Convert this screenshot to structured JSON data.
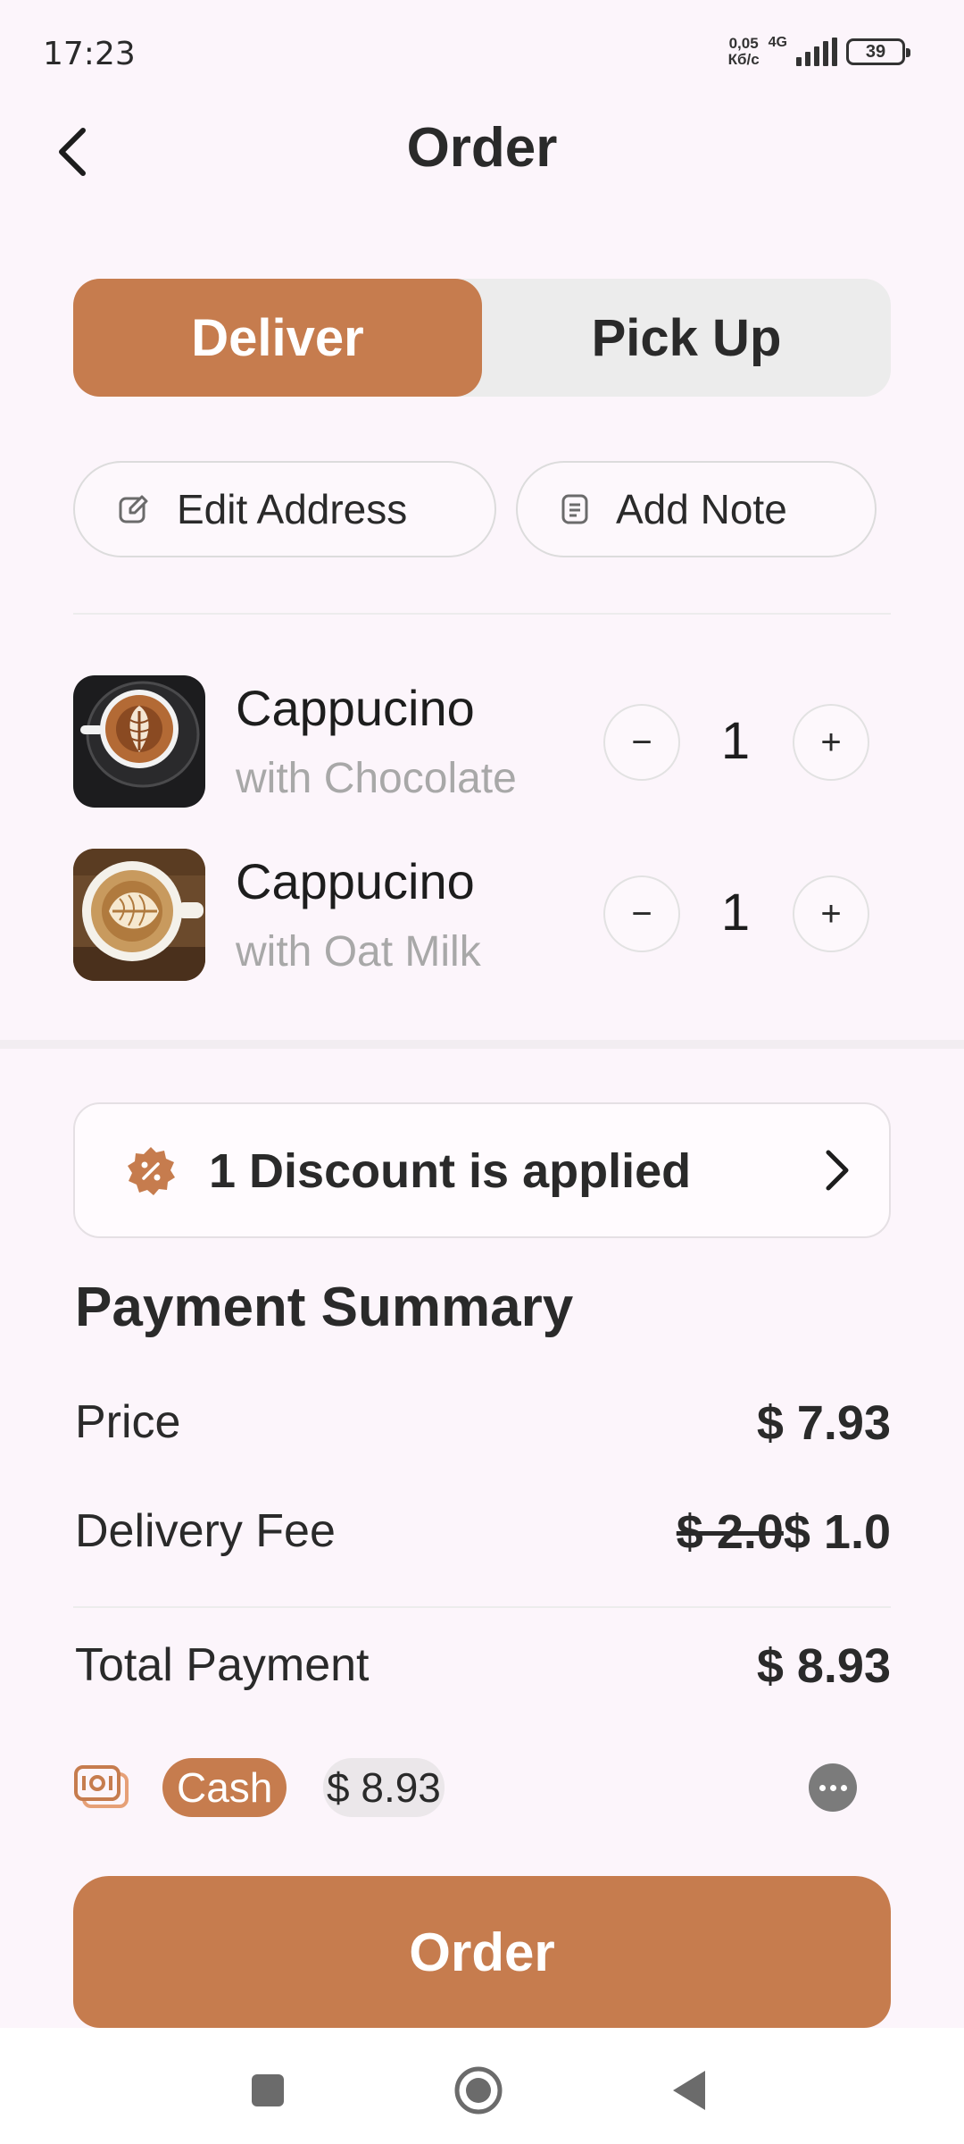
{
  "status_bar": {
    "time": "17:23",
    "net_speed_value": "0,05",
    "net_speed_unit": "Кб/с",
    "network_type": "4G",
    "battery": "39"
  },
  "header": {
    "title": "Order",
    "back_icon": "chevron-left-icon"
  },
  "mode_toggle": {
    "options": [
      "Deliver",
      "Pick Up"
    ],
    "selected": "Deliver"
  },
  "actions": {
    "edit_address": "Edit Address",
    "add_note": "Add Note"
  },
  "items": [
    {
      "name": "Cappucino",
      "variant": "with Chocolate",
      "quantity": "1",
      "decrement": "−",
      "increment": "+"
    },
    {
      "name": "Cappucino",
      "variant": "with Oat Milk",
      "quantity": "1",
      "decrement": "−",
      "increment": "+"
    }
  ],
  "discount": {
    "label": "1 Discount is applied",
    "icon": "discount-badge-icon"
  },
  "payment_summary": {
    "title": "Payment Summary",
    "price_label": "Price",
    "price_value": "$ 7.93",
    "delivery_label": "Delivery Fee",
    "delivery_original": "$ 2.0",
    "delivery_discounted": "$ 1.0",
    "total_label": "Total Payment",
    "total_value": "$ 8.93"
  },
  "payment_method": {
    "method": "Cash",
    "amount": "$ 8.93",
    "icon": "cash-icon"
  },
  "order_button": "Order",
  "colors": {
    "accent": "#c67c4e",
    "background": "#fcf5fb",
    "muted_text": "#a8a8a8"
  }
}
